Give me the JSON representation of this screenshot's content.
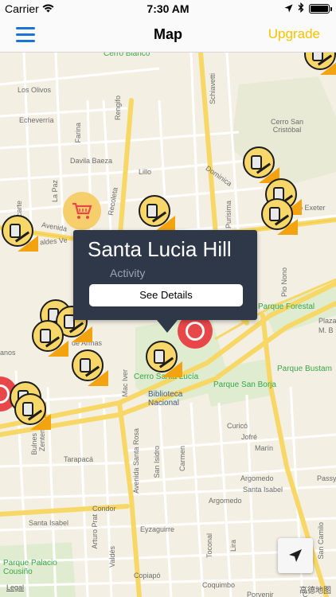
{
  "status_bar": {
    "carrier": "Carrier",
    "time": "7:30 AM",
    "battery_level": 1.0
  },
  "nav": {
    "title": "Map",
    "upgrade_label": "Upgrade",
    "upgrade_color": "#f5c400",
    "menu_color": "#1a73d9",
    "menu_icon": "hamburger-icon"
  },
  "map": {
    "labels": {
      "cerro_blanco": "Cerro Blanco",
      "schiavetti": "Schiavetti",
      "los_olivos": "Los Olivos",
      "echeverria": "Echeverría",
      "rengifo": "Rengifo",
      "farina": "Farina",
      "cerro_san_cristobal": "Cerro San\nCristóbal",
      "davila_baeza": "Davila Baeza",
      "la_paz": "La Paz",
      "lillo": "Lillo",
      "dominica": "Dominica",
      "recoleta": "Recoleta",
      "exeter": "ro Exeter",
      "picarte": "Picarte",
      "avenida": "Avenida",
      "aldes_vei": "aldes Ve",
      "purisima": "Purisima",
      "parque_forestal": "Parque Forestal",
      "pio_nono": "Pio Nono",
      "plaza": "Plaza",
      "plaza_m_b": "M. B",
      "de_armas": "de Armas",
      "anos": "anos",
      "parque_bustamante": "Parque Bustam",
      "parque_san_borja": "Parque San Borja",
      "cerro_santa_lucia": "Cerro Santa Lucía",
      "biblioteca_nacional": "Biblioteca\nNacional",
      "mac_iver": "Mac Iver",
      "curico": "Curicó",
      "jofre": "Jofré",
      "marin": "Marín",
      "avenida_santa_rosa": "Avenida Santa Rosa",
      "tarapaca": "Tarapacá",
      "san_isidro": "San Isidro",
      "carmen": "Carmen",
      "argomedo_1": "Argomedo",
      "santa_isabel_1": "Santa Isabel",
      "condor": "Condor",
      "argomedo_2": "Argomedo",
      "santa_isabel_2": "Santa Isabel",
      "arturo_prat": "Arturo Prat",
      "eyzaguirre": "Eyzaguirre",
      "valdes": "Valdés",
      "copiapo": "Copiapó",
      "coquimbo": "Coquimbo",
      "porvenir": "Porvenir",
      "lira": "Lira",
      "toconal": "Toconal",
      "zenteno": "Zenteno",
      "bulnes": "Bulnes",
      "parque_palacio": "Parque Palacio\nCousiño",
      "passy": "Passy",
      "san_camilo": "San Camilo",
      "coquimbo_c": "C"
    },
    "colors": {
      "land": "#f4efe3",
      "major_road": "#f7d866",
      "minor_road": "#ffffff",
      "park": "#cfe8b4",
      "accent": "#f2a30f"
    }
  },
  "markers": {
    "activity_icon": "hiking-activity-icon",
    "shopping_icon": "shopping-cart-icon",
    "food_icon": "restaurant-icon"
  },
  "callout": {
    "title": "Santa Lucia Hill",
    "subtitle": "Activity",
    "button_label": "See Details"
  },
  "controls": {
    "locate_icon": "location-arrow-icon",
    "legal_label": "Legal",
    "provider_label": "高德地图"
  }
}
